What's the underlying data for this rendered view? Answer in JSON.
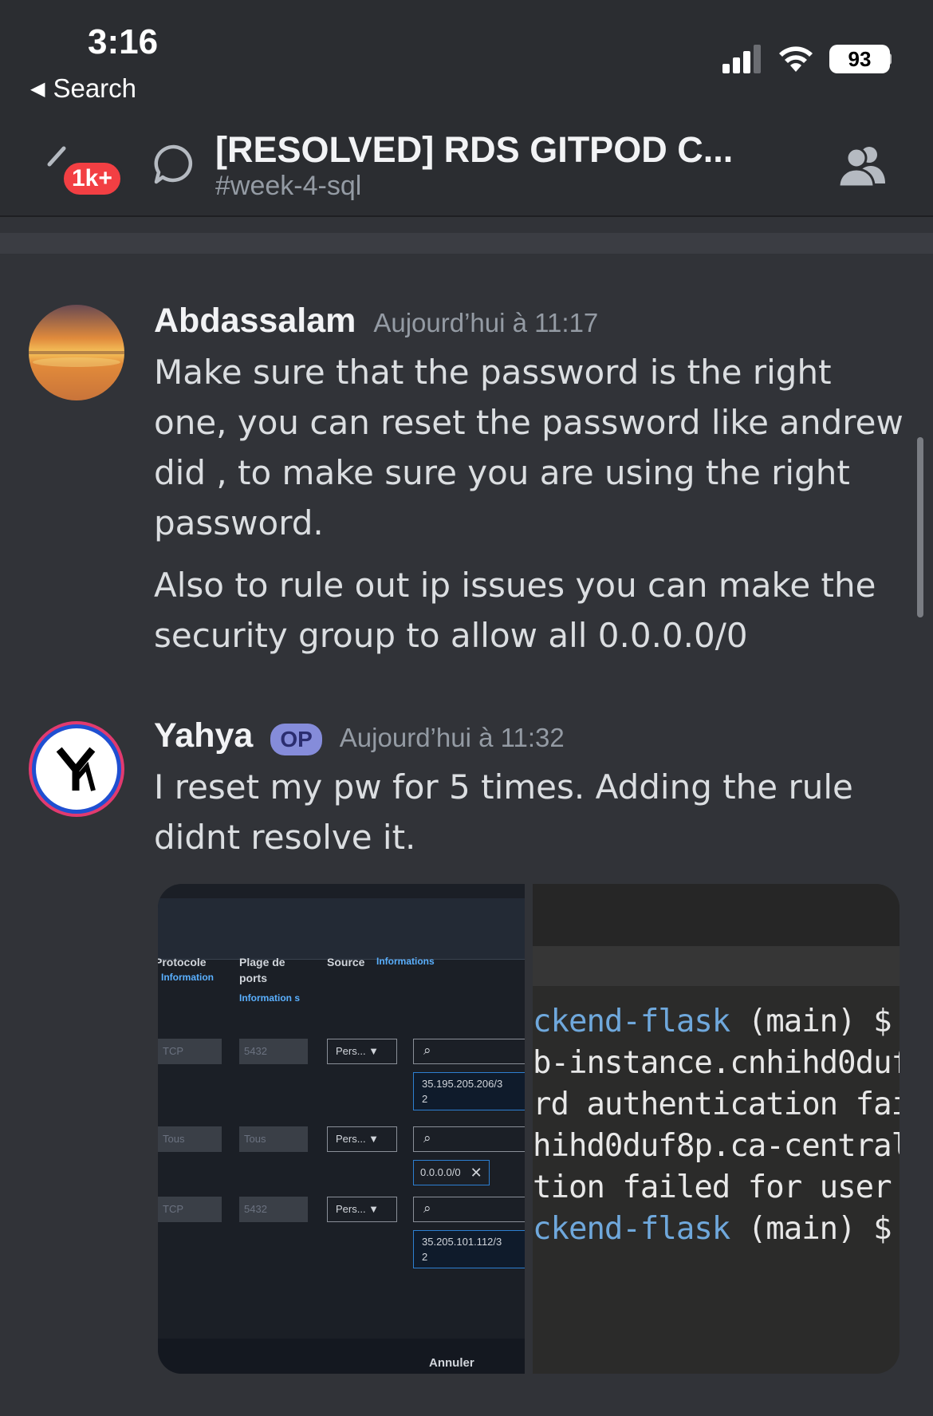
{
  "status": {
    "time": "3:16",
    "back_label": "Search",
    "battery": "93"
  },
  "header": {
    "unread_badge": "1k+",
    "title": "[RESOLVED] RDS GITPOD C...",
    "channel": "#week-4-sql"
  },
  "messages": [
    {
      "author": "Abdassalam",
      "timestamp": "Aujourd’hui à 11:17",
      "paragraphs": [
        "Make sure that the password is the right one, you can reset the password like andrew did , to make sure you are using the right password.",
        "Also to rule out ip issues you can make the security group to allow all 0.0.0.0/0"
      ]
    },
    {
      "author": "Yahya",
      "tag": "OP",
      "timestamp": "Aujourd’hui à 11:32",
      "paragraphs": [
        "I reset my pw for 5 times. Adding the rule didnt resolve it."
      ]
    }
  ],
  "attachment_aws": {
    "col_protocol": "Protocole",
    "col_protocol_info": "Information",
    "col_ports": "Plage de ports",
    "col_ports_info": "Information s",
    "col_source": "Source",
    "col_source_info": "Informations",
    "rows": [
      {
        "protocol": "TCP",
        "ports": "5432",
        "source_type": "Pers... ▼",
        "value": "35.195.205.206/3\n2"
      },
      {
        "protocol": "Tous",
        "ports": "Tous",
        "source_type": "Pers... ▼",
        "value": "0.0.0.0/0"
      },
      {
        "protocol": "TCP",
        "ports": "5432",
        "source_type": "Pers... ▼",
        "value": "35.205.101.112/3\n2"
      }
    ],
    "cancel": "Annuler"
  },
  "attachment_terminal": {
    "lines": [
      {
        "hl": "ckend-flask",
        "rest": " (main) $"
      },
      {
        "hl": "",
        "rest": "b-instance.cnhihd0duf"
      },
      {
        "hl": "",
        "rest": "rd authentication fai"
      },
      {
        "hl": "",
        "rest": "hihd0duf8p.ca-central"
      },
      {
        "hl": "",
        "rest": "tion failed for user"
      },
      {
        "hl": "ckend-flask",
        "rest": " (main) $"
      }
    ]
  },
  "colors": {
    "background": "#313338",
    "header": "#2b2d31",
    "badge": "#f23f43",
    "op_tag": "#949cf7"
  }
}
